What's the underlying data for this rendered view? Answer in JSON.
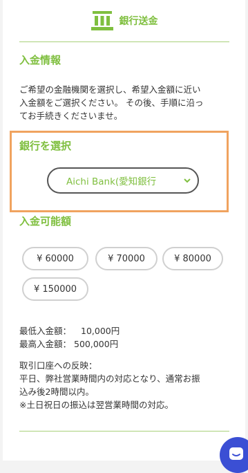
{
  "header": {
    "title": "銀行送金",
    "icon": "bank-icon",
    "accent": "#7fbf3f"
  },
  "deposit_info": {
    "title": "入金情報",
    "description_line1": "ご希望の金融機関を選択し、希望入金額に近い",
    "description_line2": "入金額をご選択ください。 その後、手順に沿っ",
    "description_line3": "てお手続きくださいませ。"
  },
  "bank_select": {
    "title": "銀行を選択",
    "selected": "Aichi Bank(愛知銀行",
    "highlight_color": "#f0a35f"
  },
  "amounts": {
    "title": "入金可能額",
    "options": [
      "¥ 60000",
      "¥ 70000",
      "¥ 80000",
      "¥ 150000"
    ]
  },
  "limits": {
    "min_label": "最低入金額：",
    "min_value": "10,000円",
    "max_label": "最高入金額：",
    "max_value": "500,000円"
  },
  "reflection": {
    "title": "取引口座への反映：",
    "line1": "平日、弊社営業時間内の対応となり、通常お振",
    "line2": "込み後2時間以内。",
    "line3": "※土日祝日の振込は翌営業時間の対応。"
  },
  "chat": {
    "icon": "chat-icon",
    "color": "#3b4fd4"
  }
}
